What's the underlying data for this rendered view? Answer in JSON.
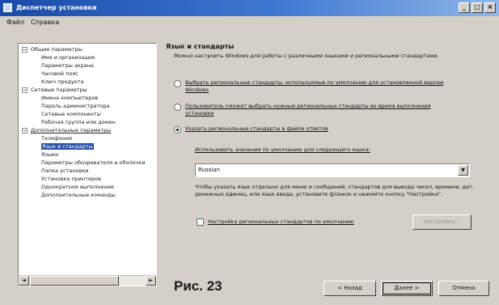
{
  "window": {
    "title": "Диспетчер установки",
    "minimize": "_",
    "maximize": "□",
    "close": "×"
  },
  "menu": [
    "Файл",
    "Справка"
  ],
  "tree": [
    {
      "label": "Общие параметры",
      "toggle": "−",
      "level": 0
    },
    {
      "label": "Имя и организация",
      "level": 1
    },
    {
      "label": "Параметры экрана",
      "level": 1
    },
    {
      "label": "Часовой пояс",
      "level": 1
    },
    {
      "label": "Ключ продукта",
      "level": 1
    },
    {
      "label": "Сетевые параметры",
      "toggle": "−",
      "level": 0
    },
    {
      "label": "Имена компьютеров",
      "level": 1
    },
    {
      "label": "Пароль администратора",
      "level": 1
    },
    {
      "label": "Сетевые компоненты",
      "level": 1
    },
    {
      "label": "Рабочая группа или домен",
      "level": 1
    },
    {
      "label": "Дополнительные параметры",
      "toggle": "−",
      "level": 0
    },
    {
      "label": "Телефония",
      "level": 1
    },
    {
      "label": "Язык и стандарты",
      "level": 1,
      "selected": true
    },
    {
      "label": "Языки",
      "level": 1
    },
    {
      "label": "Параметры обозревателя и оболочки",
      "level": 1
    },
    {
      "label": "Папка установки",
      "level": 1
    },
    {
      "label": "Установка принтеров",
      "level": 1
    },
    {
      "label": "Однократное выполнение",
      "level": 1
    },
    {
      "label": "Дополнительные команды",
      "level": 1
    }
  ],
  "scroll": {
    "left": "◄",
    "right": "►"
  },
  "main": {
    "title": "Язык и стандарты",
    "description": "Можно настроить Windows для работы с различными языками и региональными стандартами.",
    "options": [
      {
        "label": "Выбрать региональные стандарты, используемые по умолчанию для установленной версии Windows",
        "checked": false
      },
      {
        "label": "Пользователь сможет выбрать нужные региональные стандарты во время выполнения установки",
        "checked": false
      },
      {
        "label": "Указать региональные стандарты в файле ответов",
        "checked": true
      }
    ],
    "default_label": "Использовать значения по умолчанию для следующего языка:",
    "language_select": {
      "value": "Russian",
      "arrow": "▼"
    },
    "hint": "Чтобы указать язык отдельно для меню и сообщений, стандартов для вывода чисел, времени, дат, денежных единиц, или язык ввода, установите флажок и нажмите кнопку \"Настройка\".",
    "custom_checkbox_label": "Настройка региональных стандартов по умолчанию",
    "settings_button": "Настройка..."
  },
  "nav": {
    "back": "< Назад",
    "next": "Далее >",
    "cancel": "Отмена"
  },
  "caption": "Рис. 23"
}
